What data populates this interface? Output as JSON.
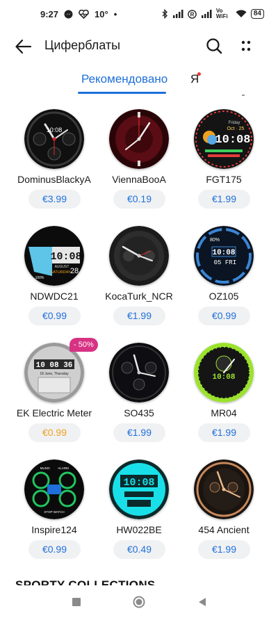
{
  "status_bar": {
    "time": "9:27",
    "temperature": "10°",
    "more_dots": "•",
    "battery": "84",
    "network": "Vo WiFi",
    "icons": [
      "messenger-icon",
      "heart-rate-icon",
      "bluetooth-icon",
      "signal-icon",
      "registered-icon",
      "wifi-icon"
    ]
  },
  "app_bar": {
    "title": "Циферблаты",
    "icons": [
      "back-arrow-icon",
      "search-icon",
      "more-vertical-dots-icon"
    ]
  },
  "tabs": [
    {
      "label": "Рекомендовано",
      "active": true
    },
    {
      "label": "Я",
      "has_notification_dot": true
    }
  ],
  "watch_faces": [
    {
      "name": "DominusBlackyA",
      "price": "€3.99",
      "preview": {
        "time": "10:08",
        "accent": "#c62828"
      }
    },
    {
      "name": "ViennaBooA",
      "price": "€0.19"
    },
    {
      "name": "FGT175",
      "price": "€1.99",
      "preview": {
        "time": "10:08",
        "day": "Friday",
        "date": "Oct · 25"
      }
    },
    {
      "name": "NDWDC21",
      "price": "€0.99",
      "preview": {
        "time": "10:08",
        "month": "AUGUST",
        "weekday": "SATURDAY",
        "day": "28",
        "percent": "100%"
      }
    },
    {
      "name": "KocaTurk_NCR",
      "price": "€1.99"
    },
    {
      "name": "OZ105",
      "price": "€0.99",
      "preview": {
        "time": "10:08",
        "day": "05",
        "weekday": "FRI",
        "percent": "80%"
      }
    },
    {
      "name": "EK Electric Meter",
      "price": "€0.99",
      "badge": "- 50%",
      "preview": {
        "time": "10 08 36",
        "date": "18 June, Thursday"
      }
    },
    {
      "name": "SO435",
      "price": "€1.99"
    },
    {
      "name": "MR04",
      "price": "€1.99",
      "preview": {
        "time": "10:08",
        "accent": "#9be22d"
      }
    },
    {
      "name": "Inspire124",
      "price": "€0.99",
      "preview": {
        "top_left": "MUSIC",
        "top_right": "ALARM",
        "bottom": "STOP WATCH"
      }
    },
    {
      "name": "HW022BE",
      "price": "€0.49",
      "preview": {
        "time": "10:08",
        "accent": "#19e0e8"
      }
    },
    {
      "name": "454 Ancient",
      "price": "€1.99"
    }
  ],
  "section_heading": "SPORTY COLLECTIONS",
  "nav_bar": {
    "icons": [
      "recents-square-icon",
      "home-circle-icon",
      "back-triangle-icon"
    ]
  }
}
